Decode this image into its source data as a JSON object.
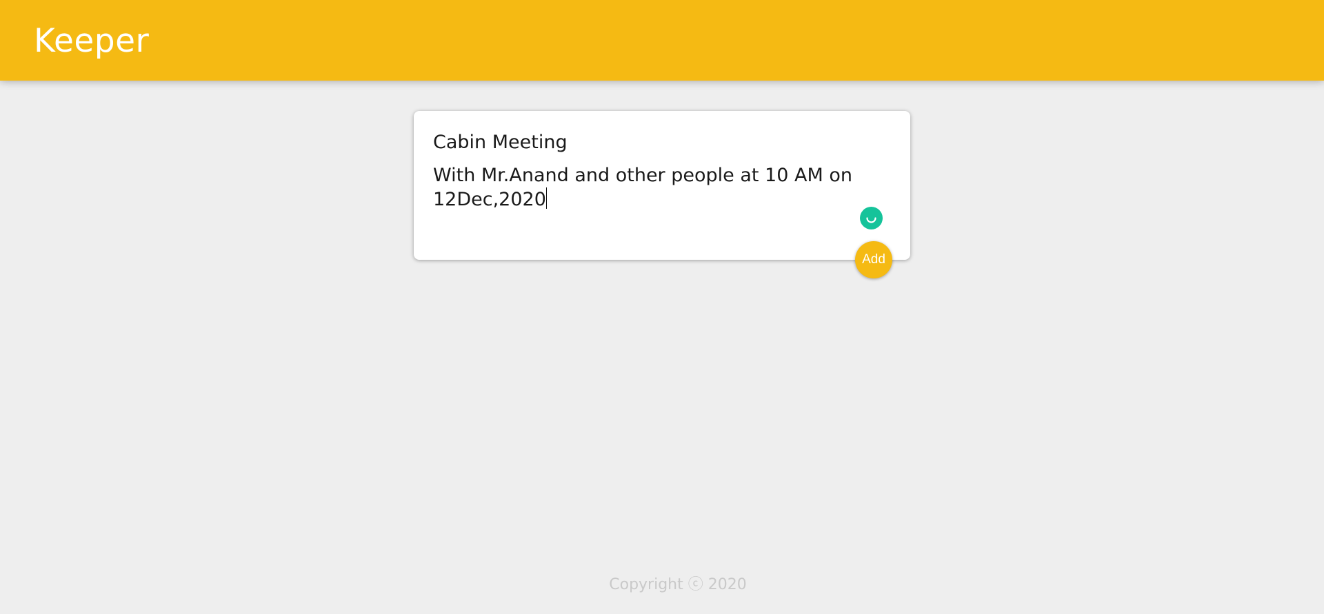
{
  "header": {
    "title": "Keeper",
    "background_color": "#f5ba13"
  },
  "note_form": {
    "title_value": "Cabin Meeting",
    "content_value": "With Mr.Anand and other people at 10 AM on 12Dec,2020",
    "add_button_label": "Add",
    "add_button_color": "#f5ba13",
    "assistant_icon": "smile-icon",
    "assistant_color": "#15c39a"
  },
  "footer": {
    "copyright": "Copyright ⓒ 2020"
  }
}
